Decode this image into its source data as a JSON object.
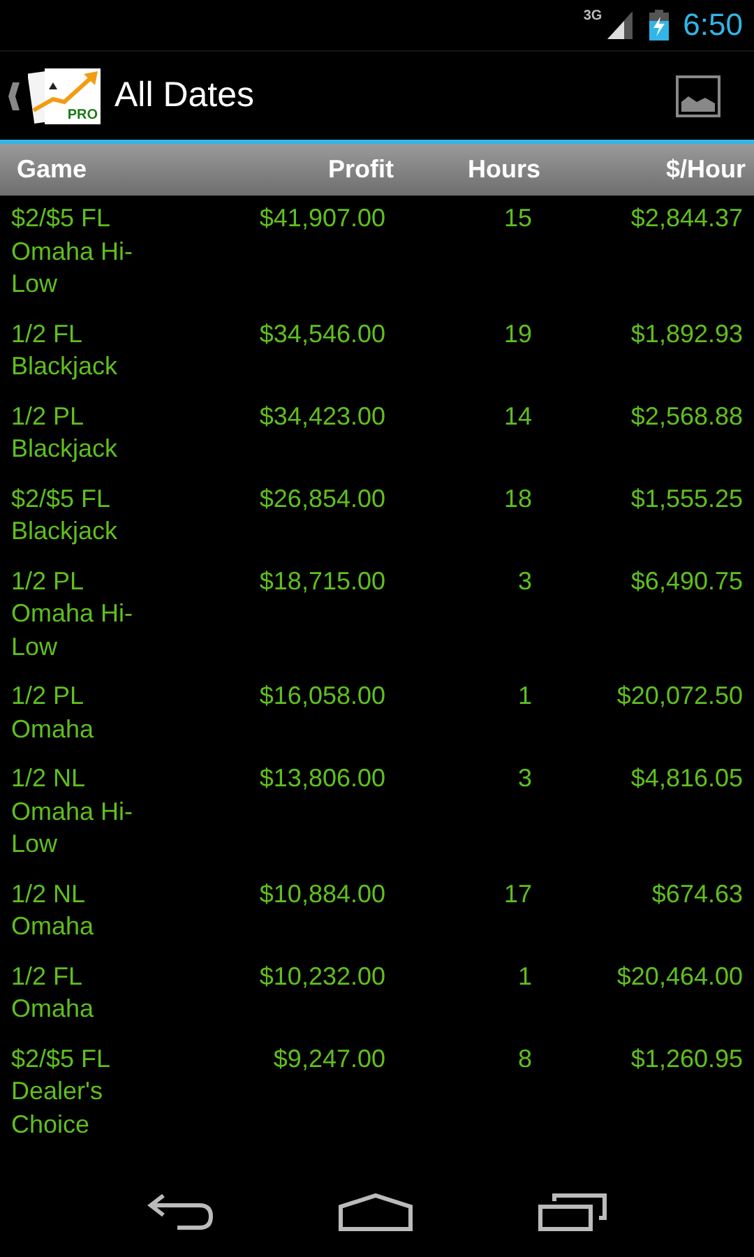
{
  "status_bar": {
    "network": "3G",
    "time": "6:50"
  },
  "action_bar": {
    "title": "All Dates",
    "logo_badge": "PRO"
  },
  "table": {
    "columns": [
      "Game",
      "Profit",
      "Hours",
      "$/Hour"
    ],
    "rows": [
      {
        "game": "$2/$5 FL Omaha Hi-Low",
        "profit": "$41,907.00",
        "hours": "15",
        "per_hour": "$2,844.37"
      },
      {
        "game": "1/2 FL Blackjack",
        "profit": "$34,546.00",
        "hours": "19",
        "per_hour": "$1,892.93"
      },
      {
        "game": "1/2 PL Blackjack",
        "profit": "$34,423.00",
        "hours": "14",
        "per_hour": "$2,568.88"
      },
      {
        "game": "$2/$5 FL Blackjack",
        "profit": "$26,854.00",
        "hours": "18",
        "per_hour": "$1,555.25"
      },
      {
        "game": "1/2 PL Omaha Hi-Low",
        "profit": "$18,715.00",
        "hours": "3",
        "per_hour": "$6,490.75"
      },
      {
        "game": "1/2 PL Omaha",
        "profit": "$16,058.00",
        "hours": "1",
        "per_hour": "$20,072.50"
      },
      {
        "game": "1/2 NL Omaha Hi-Low",
        "profit": "$13,806.00",
        "hours": "3",
        "per_hour": "$4,816.05"
      },
      {
        "game": "1/2 NL Omaha",
        "profit": "$10,884.00",
        "hours": "17",
        "per_hour": "$674.63"
      },
      {
        "game": "1/2 FL Omaha",
        "profit": "$10,232.00",
        "hours": "1",
        "per_hour": "$20,464.00"
      },
      {
        "game": "$2/$5 FL Dealer's Choice",
        "profit": "$9,247.00",
        "hours": "8",
        "per_hour": "$1,260.95"
      }
    ]
  }
}
